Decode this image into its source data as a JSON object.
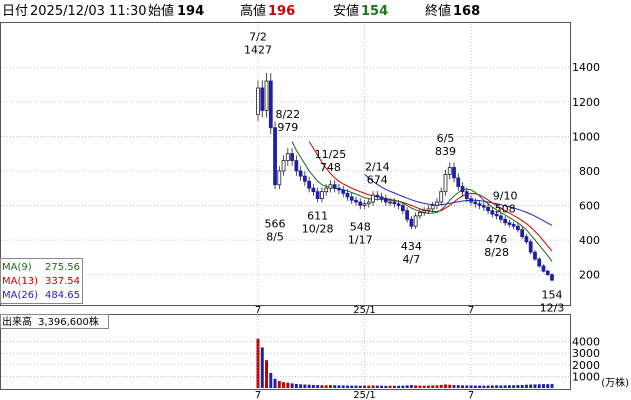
{
  "header": {
    "date_label": "日付",
    "datetime": "2025/12/03 11:30",
    "open_label": "始値",
    "open_value": "194",
    "high_label": "高値",
    "high_value": "196",
    "low_label": "安値",
    "low_value": "154",
    "close_label": "終値",
    "close_value": "168"
  },
  "colors": {
    "up": "#c00000",
    "down": "#1f1fa8",
    "ma9": "#1a6b1a",
    "ma13": "#cc0000",
    "ma26": "#2222cc",
    "grid": "#9aa0a6",
    "text": "#000000"
  },
  "ma_legend": [
    {
      "label": "MA(9)",
      "value": "275.56",
      "color": "#1a6b1a"
    },
    {
      "label": "MA(13)",
      "value": "337.54",
      "color": "#cc0000"
    },
    {
      "label": "MA(26)",
      "value": "484.65",
      "color": "#2222cc"
    }
  ],
  "volume_info": {
    "label": "出来高",
    "value": "3,396,600株"
  },
  "volume_unit": "(万株)",
  "chart_data": {
    "type": "candlestick",
    "price_axis": {
      "ticks": [
        200,
        400,
        600,
        800,
        1000,
        1200,
        1400
      ],
      "ylim": [
        30,
        1650
      ]
    },
    "volume_axis": {
      "ticks": [
        1000,
        2000,
        3000,
        4000
      ],
      "ylim": [
        0,
        5000
      ]
    },
    "x_ticks": [
      "7",
      "25/1",
      "7"
    ],
    "x_tick_index": [
      0,
      25,
      50
    ],
    "annotations": [
      {
        "label_top": "7/2",
        "label_bottom": "1427",
        "value": 1427,
        "index": 0,
        "position": "above"
      },
      {
        "label_top": "8/22",
        "label_bottom": "979",
        "value": 979,
        "index": 7,
        "position": "above"
      },
      {
        "label_top": "566",
        "label_bottom": "8/5",
        "value": 566,
        "index": 4,
        "position": "below"
      },
      {
        "label_top": "611",
        "label_bottom": "10/28",
        "value": 611,
        "index": 14,
        "position": "below"
      },
      {
        "label_top": "11/25",
        "label_bottom": "748",
        "value": 748,
        "index": 17,
        "position": "above"
      },
      {
        "label_top": "548",
        "label_bottom": "1/17",
        "value": 548,
        "index": 24,
        "position": "below"
      },
      {
        "label_top": "2/14",
        "label_bottom": "674",
        "value": 674,
        "index": 28,
        "position": "above"
      },
      {
        "label_top": "434",
        "label_bottom": "4/7",
        "value": 434,
        "index": 36,
        "position": "below"
      },
      {
        "label_top": "6/5",
        "label_bottom": "839",
        "value": 839,
        "index": 44,
        "position": "above"
      },
      {
        "label_top": "9/10",
        "label_bottom": "508",
        "value": 508,
        "index": 58,
        "position": "above"
      },
      {
        "label_top": "476",
        "label_bottom": "8/28",
        "value": 476,
        "index": 56,
        "position": "below"
      },
      {
        "label_top": "154",
        "label_bottom": "12/3",
        "value": 154,
        "index": 69,
        "position": "below"
      }
    ],
    "close": [
      1280,
      1150,
      1320,
      1050,
      720,
      800,
      860,
      900,
      860,
      800,
      770,
      740,
      700,
      680,
      640,
      680,
      700,
      720,
      700,
      690,
      670,
      650,
      630,
      620,
      600,
      610,
      620,
      660,
      650,
      640,
      620,
      620,
      610,
      600,
      570,
      520,
      480,
      540,
      560,
      570,
      580,
      600,
      620,
      680,
      780,
      820,
      760,
      710,
      680,
      640,
      620,
      610,
      600,
      590,
      570,
      550,
      540,
      520,
      500,
      490,
      480,
      460,
      420,
      390,
      330,
      290,
      250,
      220,
      200,
      168
    ],
    "volume": [
      4250,
      3500,
      2400,
      1300,
      800,
      600,
      500,
      450,
      400,
      350,
      320,
      300,
      280,
      260,
      250,
      240,
      230,
      250,
      240,
      230,
      220,
      210,
      200,
      210,
      200,
      210,
      200,
      220,
      210,
      200,
      190,
      200,
      190,
      190,
      200,
      230,
      250,
      220,
      210,
      200,
      210,
      220,
      230,
      260,
      300,
      280,
      250,
      240,
      230,
      220,
      220,
      210,
      210,
      200,
      210,
      220,
      230,
      220,
      230,
      240,
      240,
      250,
      260,
      280,
      300,
      310,
      320,
      330,
      330,
      340
    ],
    "ma9": [
      null,
      null,
      null,
      null,
      null,
      null,
      null,
      null,
      970,
      920,
      880,
      840,
      800,
      770,
      740,
      720,
      710,
      705,
      700,
      695,
      690,
      685,
      675,
      665,
      655,
      645,
      640,
      635,
      635,
      635,
      632,
      630,
      628,
      624,
      615,
      600,
      585,
      575,
      565,
      558,
      555,
      556,
      560,
      575,
      600,
      630,
      655,
      675,
      690,
      695,
      690,
      675,
      655,
      630,
      610,
      590,
      575,
      560,
      545,
      530,
      515,
      500,
      480,
      460,
      430,
      400,
      370,
      340,
      310,
      275.56
    ],
    "ma13": [
      null,
      null,
      null,
      null,
      null,
      null,
      null,
      null,
      null,
      null,
      null,
      null,
      970,
      930,
      890,
      850,
      815,
      785,
      760,
      740,
      725,
      712,
      700,
      690,
      680,
      670,
      662,
      655,
      650,
      645,
      640,
      635,
      630,
      625,
      618,
      610,
      600,
      590,
      580,
      573,
      568,
      565,
      566,
      570,
      585,
      600,
      620,
      640,
      655,
      665,
      670,
      668,
      660,
      648,
      632,
      615,
      600,
      585,
      570,
      556,
      542,
      528,
      512,
      495,
      475,
      450,
      425,
      395,
      365,
      337.54
    ],
    "ma26": [
      null,
      null,
      null,
      null,
      null,
      null,
      null,
      null,
      null,
      null,
      null,
      null,
      null,
      null,
      null,
      null,
      null,
      null,
      null,
      null,
      null,
      null,
      null,
      null,
      null,
      780,
      760,
      740,
      722,
      706,
      693,
      682,
      672,
      662,
      652,
      642,
      633,
      625,
      618,
      612,
      608,
      605,
      604,
      605,
      608,
      612,
      617,
      622,
      626,
      628,
      630,
      630,
      628,
      624,
      620,
      615,
      610,
      604,
      598,
      592,
      586,
      578,
      570,
      560,
      550,
      538,
      525,
      512,
      498,
      484.65
    ]
  }
}
